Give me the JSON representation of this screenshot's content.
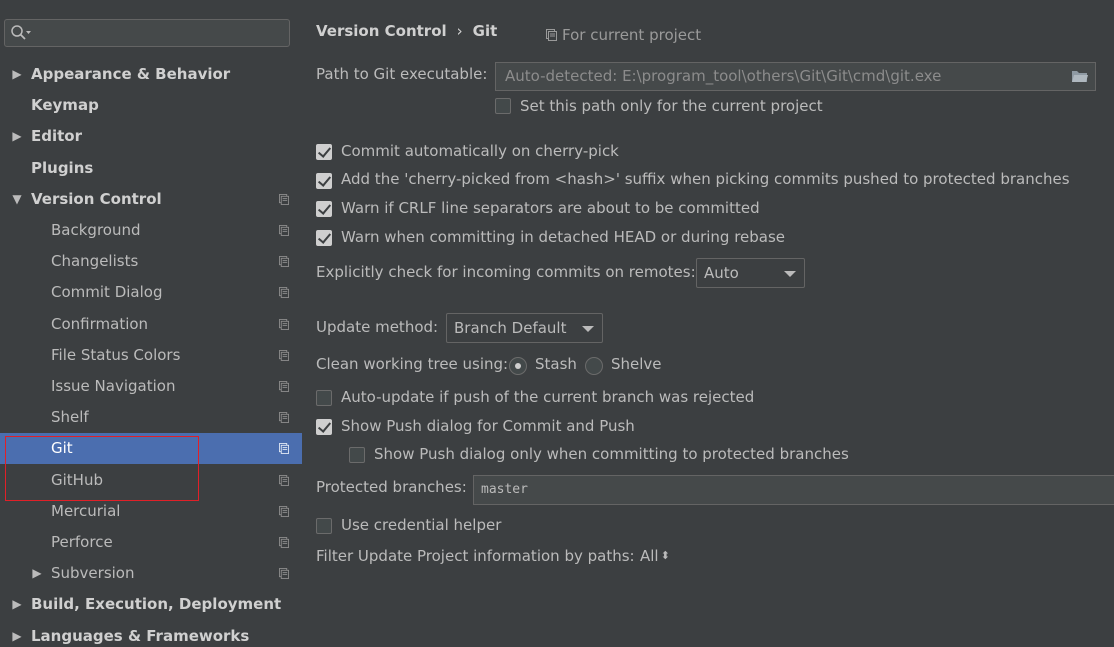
{
  "sidebar": {
    "search": {
      "value": "",
      "placeholder": ""
    },
    "items": [
      {
        "label": "Appearance & Behavior",
        "level": 0,
        "expandable": true,
        "expanded": false,
        "has_project_icon": false,
        "selected": false
      },
      {
        "label": "Keymap",
        "level": 0,
        "expandable": false,
        "expanded": false,
        "has_project_icon": false,
        "selected": false
      },
      {
        "label": "Editor",
        "level": 0,
        "expandable": true,
        "expanded": false,
        "has_project_icon": false,
        "selected": false
      },
      {
        "label": "Plugins",
        "level": 0,
        "expandable": false,
        "expanded": false,
        "has_project_icon": false,
        "selected": false
      },
      {
        "label": "Version Control",
        "level": 0,
        "expandable": true,
        "expanded": true,
        "has_project_icon": true,
        "selected": false
      },
      {
        "label": "Background",
        "level": 1,
        "expandable": false,
        "expanded": false,
        "has_project_icon": true,
        "selected": false
      },
      {
        "label": "Changelists",
        "level": 1,
        "expandable": false,
        "expanded": false,
        "has_project_icon": true,
        "selected": false
      },
      {
        "label": "Commit Dialog",
        "level": 1,
        "expandable": false,
        "expanded": false,
        "has_project_icon": true,
        "selected": false
      },
      {
        "label": "Confirmation",
        "level": 1,
        "expandable": false,
        "expanded": false,
        "has_project_icon": true,
        "selected": false
      },
      {
        "label": "File Status Colors",
        "level": 1,
        "expandable": false,
        "expanded": false,
        "has_project_icon": true,
        "selected": false
      },
      {
        "label": "Issue Navigation",
        "level": 1,
        "expandable": false,
        "expanded": false,
        "has_project_icon": true,
        "selected": false
      },
      {
        "label": "Shelf",
        "level": 1,
        "expandable": false,
        "expanded": false,
        "has_project_icon": true,
        "selected": false
      },
      {
        "label": "Git",
        "level": 1,
        "expandable": false,
        "expanded": false,
        "has_project_icon": true,
        "selected": true
      },
      {
        "label": "GitHub",
        "level": 1,
        "expandable": false,
        "expanded": false,
        "has_project_icon": true,
        "selected": false
      },
      {
        "label": "Mercurial",
        "level": 1,
        "expandable": false,
        "expanded": false,
        "has_project_icon": true,
        "selected": false
      },
      {
        "label": "Perforce",
        "level": 1,
        "expandable": false,
        "expanded": false,
        "has_project_icon": true,
        "selected": false
      },
      {
        "label": "Subversion",
        "level": 1,
        "expandable": true,
        "expanded": false,
        "has_project_icon": true,
        "selected": false
      },
      {
        "label": "Build, Execution, Deployment",
        "level": 0,
        "expandable": true,
        "expanded": false,
        "has_project_icon": false,
        "selected": false
      },
      {
        "label": "Languages & Frameworks",
        "level": 0,
        "expandable": true,
        "expanded": false,
        "has_project_icon": false,
        "selected": false
      }
    ]
  },
  "header": {
    "breadcrumb_parent": "Version Control",
    "breadcrumb_separator": "›",
    "breadcrumb_current": "Git",
    "scope_label": "For current project"
  },
  "git": {
    "path_label": "Path to Git executable:",
    "path_placeholder": "Auto-detected: E:\\program_tool\\others\\Git\\Git\\cmd\\git.exe",
    "path_only_project_label": "Set this path only for the current project",
    "path_only_project_checked": false,
    "cherry_pick_commit_label": "Commit automatically on cherry-pick",
    "cherry_pick_commit_checked": true,
    "cherry_pick_suffix_label": "Add the 'cherry-picked from <hash>' suffix when picking commits pushed to protected branches",
    "cherry_pick_suffix_checked": true,
    "crlf_warn_label": "Warn if CRLF line separators are about to be committed",
    "crlf_warn_checked": true,
    "detached_head_label": "Warn when committing in detached HEAD or during rebase",
    "detached_head_checked": true,
    "incoming_label": "Explicitly check for incoming commits on remotes:",
    "incoming_value": "Auto",
    "update_method_label": "Update method:",
    "update_method_value": "Branch Default",
    "clean_tree_label": "Clean working tree using:",
    "clean_stash_label": "Stash",
    "clean_shelve_label": "Shelve",
    "clean_selected": "Stash",
    "auto_update_label": "Auto-update if push of the current branch was rejected",
    "auto_update_checked": false,
    "show_push_label": "Show Push dialog for Commit and Push",
    "show_push_checked": true,
    "show_push_protected_label": "Show Push dialog only when committing to protected branches",
    "show_push_protected_checked": false,
    "protected_label": "Protected branches:",
    "protected_value": "master",
    "credential_label": "Use credential helper",
    "credential_checked": false,
    "filter_label": "Filter Update Project information by paths:",
    "filter_value": "All"
  },
  "colors": {
    "background": "#3c3f41",
    "selection": "#4b6eaf",
    "text": "#bbbbbb",
    "highlight_box": "#e02028"
  }
}
